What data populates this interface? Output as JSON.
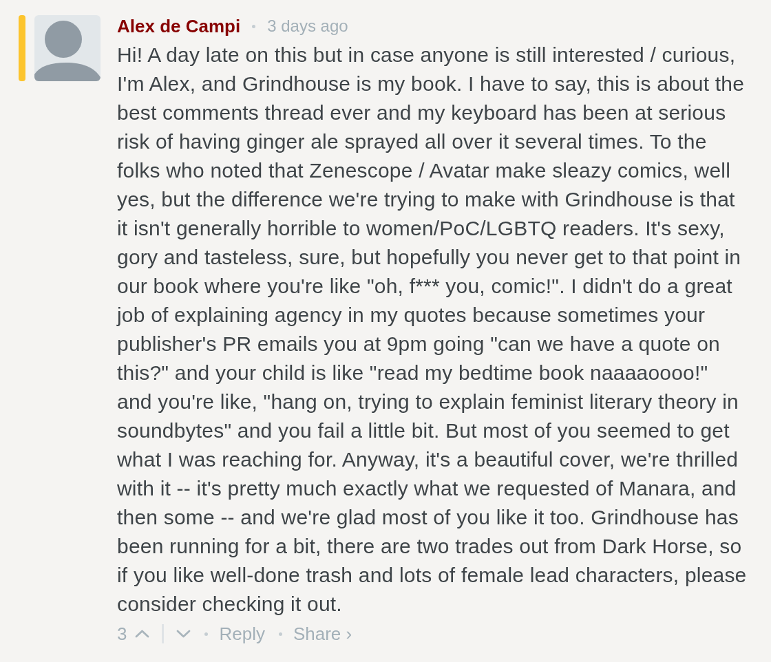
{
  "comment": {
    "highlighted": true,
    "author": "Alex de Campi",
    "time": "3 days ago",
    "body": "Hi! A day late on this but in case anyone is still interested / curious, I'm Alex, and Grindhouse is my book. I have to say, this is about the best comments thread ever and my keyboard has been at serious risk of having ginger ale sprayed all over it several times. To the folks who noted that Zenescope / Avatar make sleazy comics, well yes, but the difference we're trying to make with Grindhouse is that it isn't generally horrible to women/PoC/LGBTQ readers. It's sexy, gory and tasteless, sure, but hopefully you never get to that point in our book where you're like \"oh, f*** you, comic!\". I didn't do a great job of explaining agency in my quotes because sometimes your publisher's PR emails you at 9pm going \"can we have a quote on this?\" and your child is like \"read my bedtime book naaaaoooo!\" and you're like, \"hang on, trying to explain feminist literary theory in soundbytes\" and you fail a little bit. But most of you seemed to get what I was reaching for. Anyway, it's a beautiful cover, we're thrilled with it -- it's pretty much exactly what we requested of Manara, and then some -- and we're glad most of you like it too. Grindhouse has been running for a bit, there are two trades out from Dark Horse, so if you like well-done trash and lots of female lead characters, please consider checking it out.",
    "footer": {
      "votes": "3",
      "actions": [
        "Reply",
        "Share ›"
      ]
    }
  }
}
